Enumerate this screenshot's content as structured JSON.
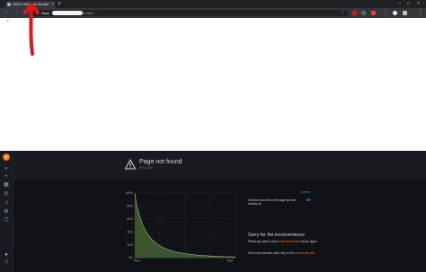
{
  "browser": {
    "tab_title": "ASUS Wireless Router",
    "new_tab_symbol": "+",
    "url_prefix": "https",
    "url_tail": "/router/",
    "menu_symbol": "⋮"
  },
  "app": {
    "page_title": "Page not found",
    "page_subtitle": "Error 404",
    "hint_text": "Chances you are on the page you are looking for.",
    "hint_link": "current",
    "hint_value": "0%",
    "sorry_title": "Sorry for the inconvenience",
    "sorry_line_pre": "Please go back to your ",
    "sorry_line_link": "home dashboard",
    "sorry_line_post": " and try again.",
    "error_line_pre": "If the error persists, seek help on the ",
    "error_line_link": "community site",
    "error_line_post": "."
  },
  "chart_data": {
    "type": "area",
    "title": "",
    "xlabel": "",
    "ylabel": "",
    "x_ticks": [
      "Then",
      "Now"
    ],
    "y_ticks": [
      "100%",
      "80%",
      "60%",
      "40%",
      "20%",
      "0%"
    ],
    "ylim": [
      0,
      100
    ],
    "grid": true,
    "series": [
      {
        "x": [
          0,
          0.02,
          0.05,
          0.08,
          0.12,
          0.17,
          0.23,
          0.3,
          0.4,
          0.5,
          0.62,
          0.75,
          0.88,
          1.0
        ],
        "values": [
          100,
          80,
          63,
          50,
          38,
          28,
          20,
          14,
          9,
          6,
          4,
          2.5,
          1.5,
          1
        ],
        "color": "#4b6b3a"
      }
    ]
  }
}
